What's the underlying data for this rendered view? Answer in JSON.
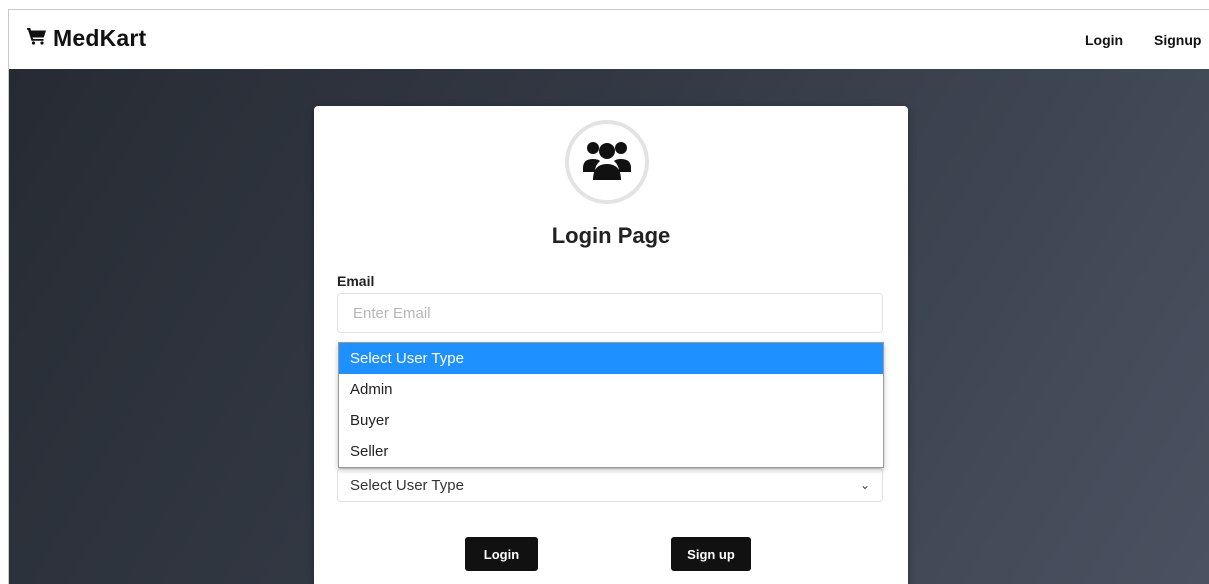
{
  "navbar": {
    "brand": "MedKart",
    "brand_icon": "shopping-cart-icon",
    "links": {
      "login": "Login",
      "signup": "Signup"
    }
  },
  "login_card": {
    "avatar_icon": "users-icon",
    "title": "Login Page",
    "email": {
      "label": "Email",
      "placeholder": "Enter Email",
      "value": ""
    },
    "user_type": {
      "selected": "Select User Type",
      "options": [
        "Select User Type",
        "Admin",
        "Buyer",
        "Seller"
      ],
      "highlighted_option": "Select User Type"
    },
    "buttons": {
      "login": "Login",
      "signup": "Sign up"
    }
  },
  "colors": {
    "dropdown_highlight": "#1e90ff",
    "button_bg": "#111111",
    "background_dark": "#262b33"
  }
}
